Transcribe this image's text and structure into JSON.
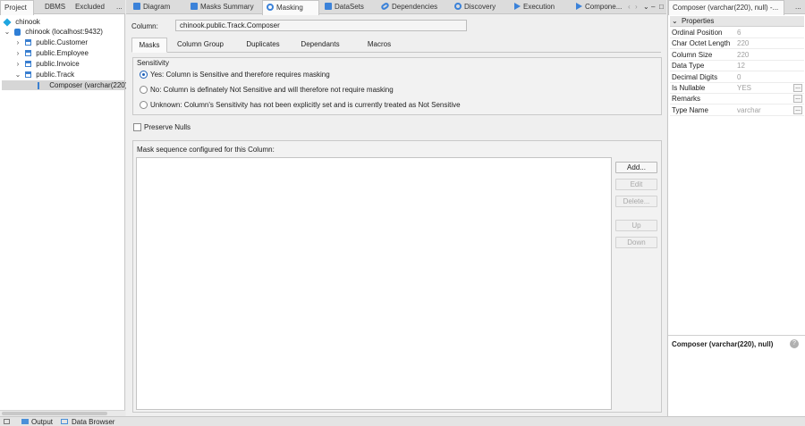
{
  "left_panel": {
    "tabs": [
      "Project",
      "DBMS",
      "Excluded"
    ],
    "menu_label": "...",
    "tree": {
      "root": "chinook",
      "connection": "chinook (localhost:9432)",
      "tables": [
        "public.Customer",
        "public.Employee",
        "public.Invoice",
        "public.Track"
      ],
      "column": "Composer (varchar(220),"
    }
  },
  "editor_tabs": {
    "tabs": [
      "Diagram",
      "Masks Summary",
      "Masking",
      "DataSets",
      "Dependencies",
      "Discovery",
      "Execution",
      "Compone..."
    ],
    "active": "Masking",
    "nav_left": "‹",
    "nav_right": "›",
    "overflow": "⌄",
    "minimize": "–",
    "maximize": "□"
  },
  "column_field": {
    "label": "Column:",
    "value": "chinook.public.Track.Composer"
  },
  "subtabs": {
    "items": [
      "Masks",
      "Column Group",
      "Duplicates",
      "Dependants",
      "Macros"
    ],
    "active": "Masks"
  },
  "sensitivity": {
    "title": "Sensitivity",
    "options": [
      "Yes: Column is Sensitive and therefore requires masking",
      "No: Column is definately Not Sensitive and will therefore not require masking",
      "Unknown: Column's Sensitivity has not been explicitly set and is currently treated as Not Sensitive"
    ],
    "selected_index": 0
  },
  "preserve_nulls": {
    "label": "Preserve Nulls",
    "checked": false
  },
  "mask_sequence": {
    "title": "Mask sequence configured for this Column:",
    "buttons": {
      "add": "Add...",
      "edit": "Edit",
      "delete": "Delete...",
      "up": "Up",
      "down": "Down"
    }
  },
  "properties_panel": {
    "tab_title": "Composer (varchar(220), null) -...",
    "menu_label": "...",
    "section_label": "Properties",
    "rows": [
      {
        "name": "Ordinal Position",
        "value": "6"
      },
      {
        "name": "Char Octet Length",
        "value": "220"
      },
      {
        "name": "Column Size",
        "value": "220"
      },
      {
        "name": "Data Type",
        "value": "12"
      },
      {
        "name": "Decimal Digits",
        "value": "0"
      },
      {
        "name": "Is Nullable",
        "value": "YES"
      },
      {
        "name": "Remarks",
        "value": ""
      },
      {
        "name": "Type Name",
        "value": "varchar"
      }
    ],
    "row_button": "...",
    "description_title": "Composer (varchar(220), null)",
    "help_symbol": "?"
  },
  "bottom_bar": {
    "tabs": [
      "Output",
      "Data Browser"
    ]
  },
  "colors": {
    "accent": "#3b82d9",
    "selected_row": "#d6d6d6",
    "disabled_text": "#a8a8a8"
  }
}
